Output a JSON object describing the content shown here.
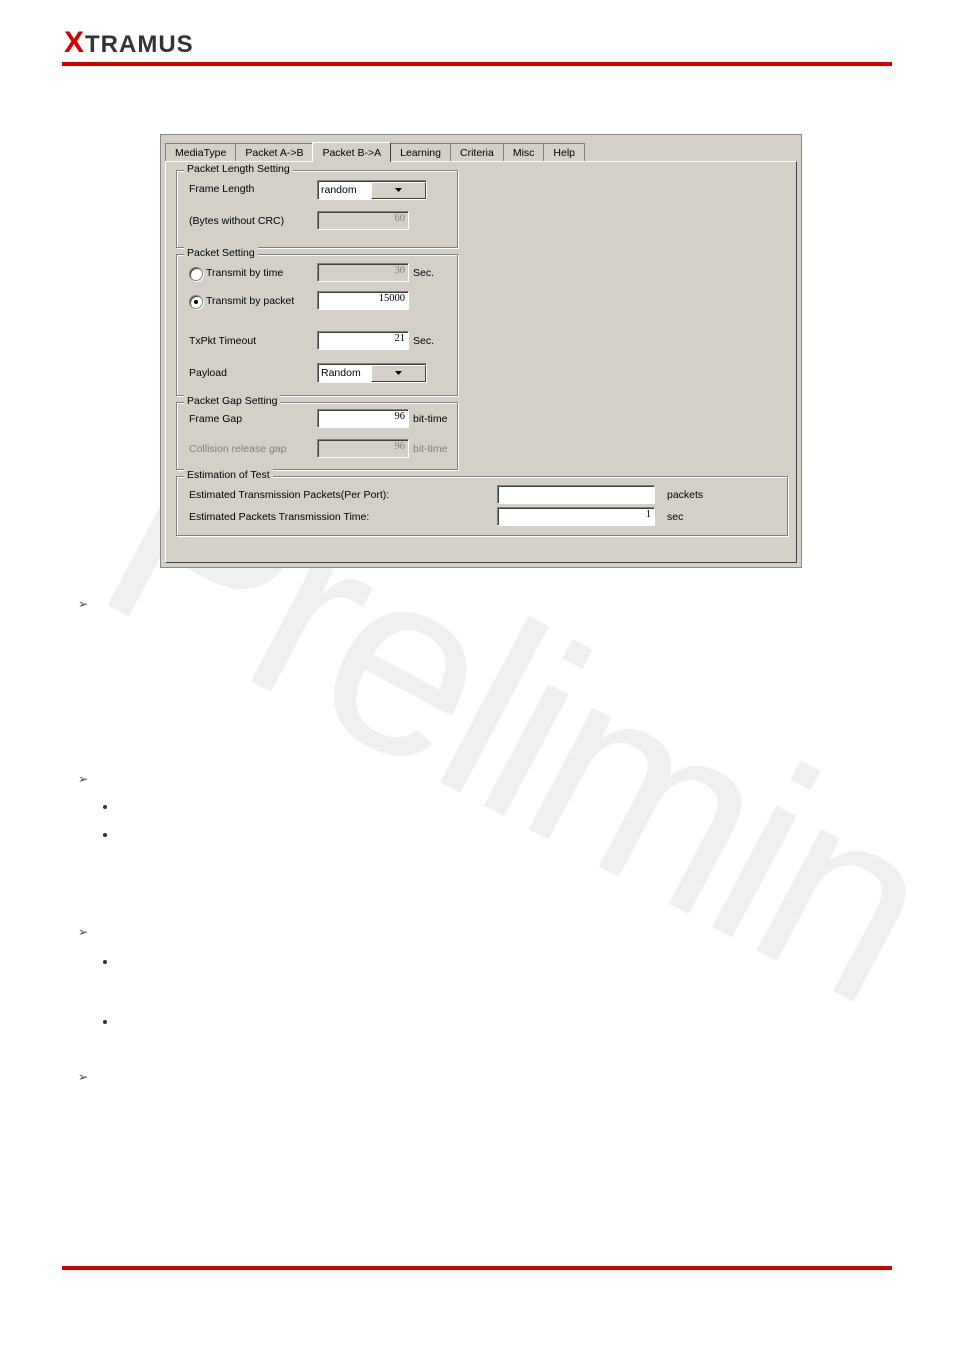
{
  "logo": {
    "x": "X",
    "rest": "TRAMUS"
  },
  "tabs": {
    "items": [
      "MediaType",
      "Packet A->B",
      "Packet B->A",
      "Learning",
      "Criteria",
      "Misc",
      "Help"
    ],
    "selected_index": 2
  },
  "packet_length": {
    "title": "Packet Length Setting",
    "frame_length_label": "Frame Length",
    "frame_length_value": "random",
    "bytes_label": "(Bytes without CRC)",
    "bytes_value": "60"
  },
  "packet_setting": {
    "title": "Packet Setting",
    "by_time_label": "Transmit by time",
    "by_time_value": "30",
    "by_time_unit": "Sec.",
    "by_packet_label": "Transmit by packet",
    "by_packet_value": "15000",
    "timeout_label": "TxPkt Timeout",
    "timeout_value": "21",
    "timeout_unit": "Sec.",
    "payload_label": "Payload",
    "payload_value": "Random"
  },
  "gap": {
    "title": "Packet Gap Setting",
    "frame_gap_label": "Frame Gap",
    "frame_gap_value": "96",
    "frame_gap_unit": "bit-time",
    "collision_label": "Collision release gap",
    "collision_value": "96",
    "collision_unit": "bit-time"
  },
  "est": {
    "title": "Estimation of Test",
    "packets_label": "Estimated Transmission Packets(Per Port):",
    "packets_value": "",
    "packets_unit": "packets",
    "time_label": "Estimated Packets Transmission Time:",
    "time_value": "1",
    "time_unit": "sec"
  },
  "watermark": "Prelimin"
}
